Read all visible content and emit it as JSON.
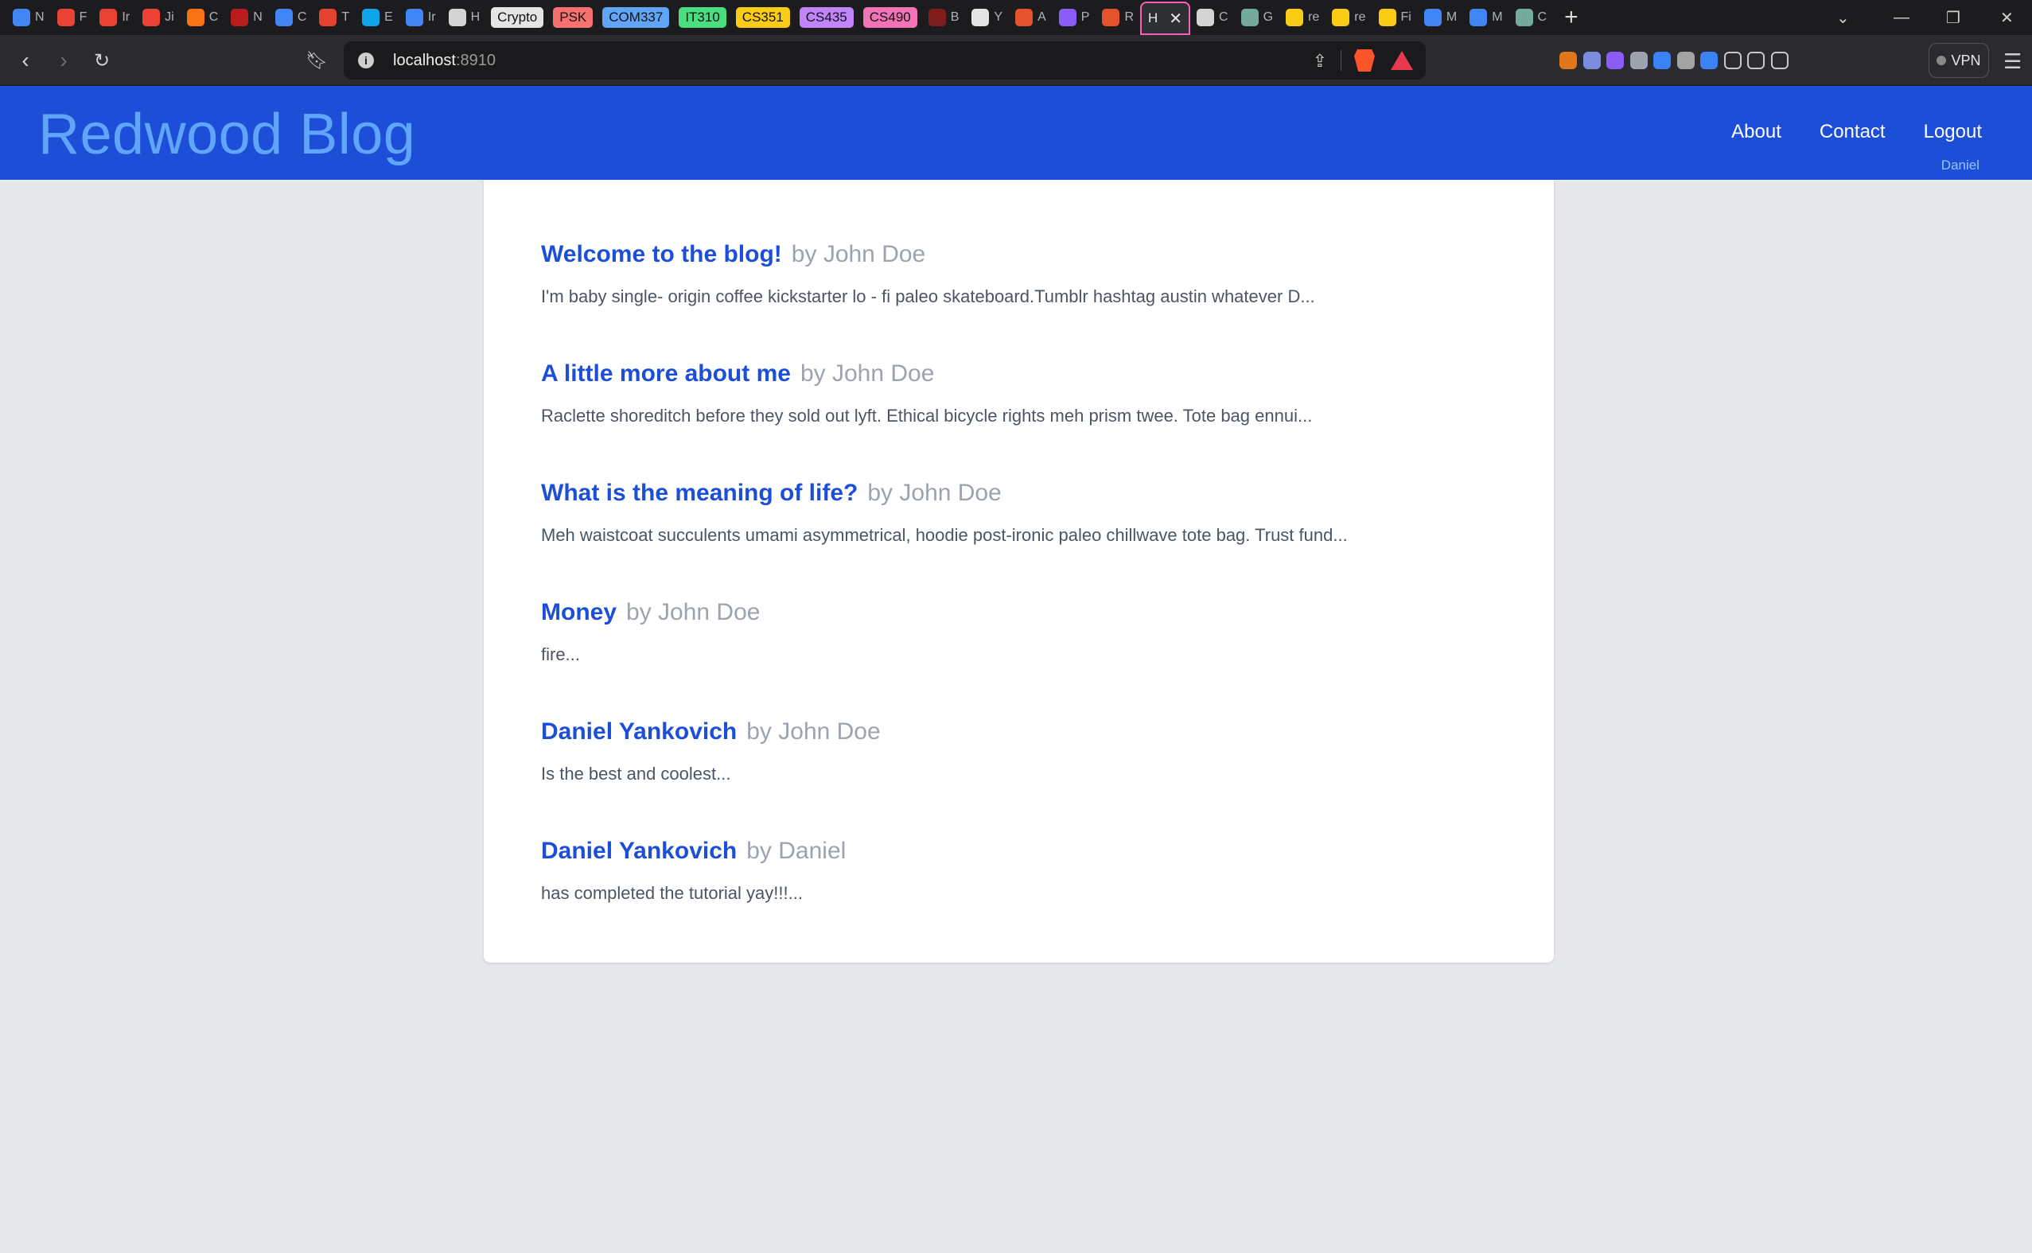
{
  "browser": {
    "tabs": [
      {
        "icon": "calendar-icon",
        "color": "#4285f4",
        "label": "N"
      },
      {
        "icon": "gmail-icon",
        "color": "#ea4335",
        "label": "F"
      },
      {
        "icon": "gmail-icon",
        "color": "#ea4335",
        "label": "Ir"
      },
      {
        "icon": "gmail-icon",
        "color": "#ea4335",
        "label": "Ji"
      },
      {
        "icon": "flame-icon",
        "color": "#f97316",
        "label": "C"
      },
      {
        "icon": "red-logo-icon",
        "color": "#b91c1c",
        "label": "N"
      },
      {
        "icon": "docs-icon",
        "color": "#4285f4",
        "label": "C"
      },
      {
        "icon": "todoist-icon",
        "color": "#e44332",
        "label": "T"
      },
      {
        "icon": "cloud-icon",
        "color": "#0ea5e9",
        "label": "E"
      },
      {
        "icon": "docs-icon",
        "color": "#4285f4",
        "label": "Ir"
      },
      {
        "icon": "globe-icon",
        "color": "#d4d4d4",
        "label": "H"
      }
    ],
    "groups": [
      {
        "label": "Crypto",
        "color": "#e5e5e5"
      },
      {
        "label": "PSK",
        "color": "#f87171"
      },
      {
        "label": "COM337",
        "color": "#60a5fa"
      },
      {
        "label": "IT310",
        "color": "#4ade80"
      },
      {
        "label": "CS351",
        "color": "#facc15"
      },
      {
        "label": "CS435",
        "color": "#c084fc"
      },
      {
        "label": "CS490",
        "color": "#f472b6"
      }
    ],
    "tabs_after": [
      {
        "icon": "red-logo-icon",
        "color": "#7f1d1d",
        "label": "B"
      },
      {
        "icon": "github-icon",
        "color": "#e5e5e5",
        "label": "Y"
      },
      {
        "icon": "redwood-icon",
        "color": "#e5532d",
        "label": "A"
      },
      {
        "icon": "purple-app-icon",
        "color": "#8b5cf6",
        "label": "P"
      },
      {
        "icon": "redwood-icon",
        "color": "#e5532d",
        "label": "R"
      }
    ],
    "active_tab": {
      "label": "H",
      "close": "✕"
    },
    "tabs_end": [
      {
        "icon": "globe-icon",
        "color": "#d4d4d4",
        "label": "C"
      },
      {
        "icon": "chatgpt-icon",
        "color": "#74aa9c",
        "label": "G"
      },
      {
        "icon": "yellow-circle-icon",
        "color": "#facc15",
        "label": "re"
      },
      {
        "icon": "yellow-circle-icon",
        "color": "#facc15",
        "label": "re"
      },
      {
        "icon": "yellow-circle-icon",
        "color": "#facc15",
        "label": "Fi"
      },
      {
        "icon": "docs-icon",
        "color": "#4285f4",
        "label": "M"
      },
      {
        "icon": "docs-icon",
        "color": "#4285f4",
        "label": "M"
      },
      {
        "icon": "chatgpt-icon",
        "color": "#74aa9c",
        "label": "C"
      }
    ],
    "new_tab": "+",
    "url_host": "localhost",
    "url_port": ":8910",
    "vpn_label": "VPN",
    "extensions": [
      "metamask-icon",
      "blue-ext-icon",
      "purple-ext-icon",
      "fb-ext-icon",
      "drop-ext-icon",
      "slash-ext-icon",
      "blue-arrow-ext-icon",
      "puzzle-icon",
      "sidebar-icon",
      "wallet-icon"
    ]
  },
  "site": {
    "title": "Redwood Blog",
    "nav": {
      "about": "About",
      "contact": "Contact",
      "logout": "Logout"
    },
    "user": "Daniel",
    "accent": "#1d4ed8",
    "title_color": "#60a5fa"
  },
  "posts": [
    {
      "title": "Welcome to the blog!",
      "author": "by John Doe",
      "excerpt": "I'm baby single- origin coffee kickstarter lo - fi paleo skateboard.Tumblr hashtag austin whatever D..."
    },
    {
      "title": "A little more about me",
      "author": "by John Doe",
      "excerpt": "Raclette shoreditch before they sold out lyft. Ethical bicycle rights meh prism twee. Tote bag ennui..."
    },
    {
      "title": "What is the meaning of life?",
      "author": "by John Doe",
      "excerpt": "Meh waistcoat succulents umami asymmetrical, hoodie post-ironic paleo chillwave tote bag. Trust fund..."
    },
    {
      "title": "Money",
      "author": "by John Doe",
      "excerpt": "fire..."
    },
    {
      "title": "Daniel Yankovich",
      "author": "by John Doe",
      "excerpt": "Is the best and coolest..."
    },
    {
      "title": "Daniel Yankovich",
      "author": "by Daniel",
      "excerpt": "has completed the tutorial yay!!!..."
    }
  ]
}
